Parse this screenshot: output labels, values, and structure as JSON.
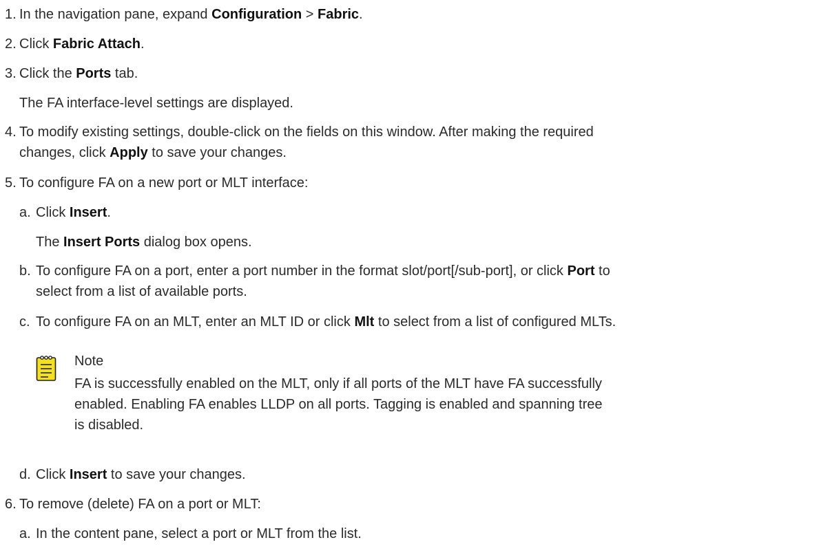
{
  "steps": [
    {
      "num": "1.",
      "pre": "In the navigation pane, expand ",
      "b1": "Configuration",
      "mid": " > ",
      "b2": "Fabric",
      "post": "."
    },
    {
      "num": "2.",
      "pre": "Click ",
      "b1": "Fabric Attach",
      "post": "."
    },
    {
      "num": "3.",
      "pre": "Click the ",
      "b1": "Ports",
      "post": " tab."
    },
    {
      "result": "The FA interface-level settings are displayed."
    },
    {
      "num": "4.",
      "line1": "To modify existing settings, double-click on the fields on this window. After making the required",
      "pre": "changes, click ",
      "b1": "Apply",
      "post": " to save your changes."
    },
    {
      "num": "5.",
      "text": "To configure FA on a new port or MLT interface:"
    },
    {
      "num": "6.",
      "text": "To remove (delete) FA on a port or MLT:"
    }
  ],
  "substeps5": [
    {
      "letter": "a.",
      "pre": "Click ",
      "b1": "Insert",
      "post": "."
    },
    {
      "result_pre": "The ",
      "result_b": "Insert Ports",
      "result_post": " dialog box opens."
    },
    {
      "letter": "b.",
      "pre": "To configure FA on a port, enter a port number in the format slot/port[/sub-port], or click ",
      "b1": "Port",
      "post": " to",
      "line2": "select from a list of available ports."
    },
    {
      "letter": "c.",
      "pre": "To configure FA on an MLT, enter an MLT ID or click ",
      "b1": "Mlt",
      "post": " to select from a list of configured MLTs."
    },
    {
      "letter": "d.",
      "pre": "Click ",
      "b1": "Insert",
      "post": " to save your changes."
    }
  ],
  "substeps6": [
    {
      "letter": "a.",
      "text": "In the content pane, select a port or MLT from the list."
    }
  ],
  "note": {
    "title": "Note",
    "lines": [
      "FA is successfully enabled on the MLT, only if all ports of the MLT have FA successfully",
      "enabled. Enabling FA enables LLDP on all ports. Tagging is enabled and spanning tree",
      "is disabled."
    ],
    "icon_color": "#f5e11b"
  }
}
